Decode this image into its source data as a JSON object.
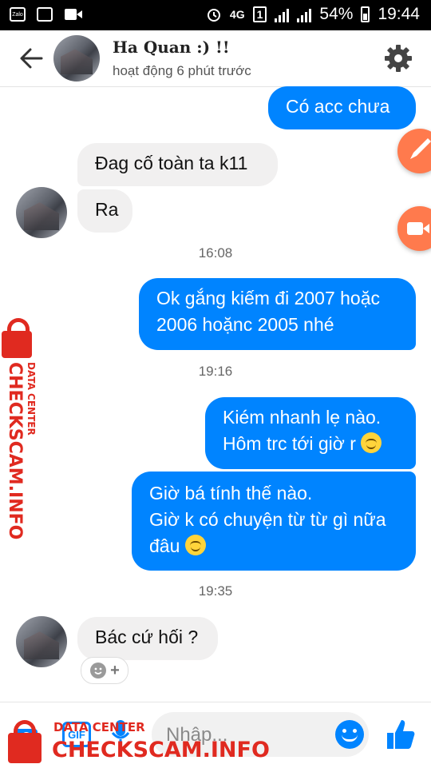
{
  "status_bar": {
    "network": "4G",
    "sim": "1",
    "battery": "54%",
    "time": "19:44",
    "icons": [
      "zalo-icon",
      "gallery-icon",
      "video-icon",
      "alarm-icon",
      "signal-icon",
      "battery-icon"
    ],
    "zalo_label": "Zalo"
  },
  "header": {
    "name": "Ha Quan :) !!",
    "status": "hoạt động 6 phút trước"
  },
  "messages": [
    {
      "side": "out",
      "text": "Có acc chưa"
    },
    {
      "side": "in",
      "text": "Đag cố toàn ta k11"
    },
    {
      "side": "in",
      "text": "Ra"
    },
    {
      "time": "16:08"
    },
    {
      "side": "out",
      "lines": [
        "Ok gắng kiếm đi 2007 hoặc",
        "2006 hoặnc 2005 nhé"
      ]
    },
    {
      "time": "19:16"
    },
    {
      "side": "out",
      "lines": [
        "Kiém nhanh lẹ nào.",
        "Hôm trc tới giờ r"
      ]
    },
    {
      "side": "out",
      "lines": [
        "Giờ bá tính thế nào.",
        "Giờ k có chuyện từ từ gì nữa",
        "đâu"
      ]
    },
    {
      "time": "19:35"
    },
    {
      "side": "in",
      "text": "Bác cứ hối ?"
    }
  ],
  "reaction": {
    "plus": "+"
  },
  "watermark": {
    "small": "DATA CENTER",
    "big": "CHECKSCAM.INFO",
    "color": "#e02a20"
  },
  "composer": {
    "placeholder": "Nhập...",
    "gif_label": "GIF"
  },
  "colors": {
    "accent": "#0084ff",
    "incoming_bubble": "#f1f0f0",
    "side_button": "#ff7a4d"
  }
}
